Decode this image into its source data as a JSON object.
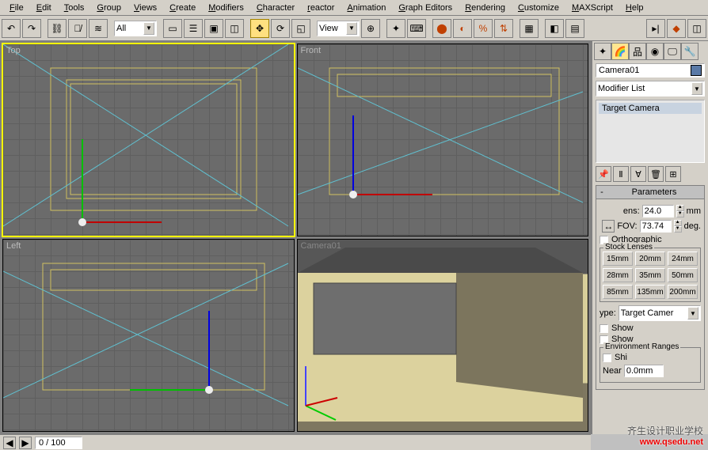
{
  "menu": {
    "file": "File",
    "edit": "Edit",
    "tools": "Tools",
    "group": "Group",
    "views": "Views",
    "create": "Create",
    "modifiers": "Modifiers",
    "character": "Character",
    "reactor": "reactor",
    "animation": "Animation",
    "graph_editors": "Graph Editors",
    "rendering": "Rendering",
    "customize": "Customize",
    "maxscript": "MAXScript",
    "help": "Help"
  },
  "toolbar": {
    "selection_filter": "All",
    "view_combo": "View"
  },
  "viewports": {
    "top": "Top",
    "front": "Front",
    "left": "Left",
    "camera": "Camera01"
  },
  "cmdpanel": {
    "object_name": "Camera01",
    "color": "#5a7aa7",
    "modifier_list_label": "Modifier List",
    "stack_item": "Target Camera"
  },
  "params": {
    "title": "Parameters",
    "lens_label": "ens:",
    "lens_value": "24.0",
    "lens_unit": "mm",
    "fov_label": "FOV:",
    "fov_value": "73.74",
    "fov_unit": "deg.",
    "ortho_label": "Orthographic",
    "stock_title": "Stock Lenses",
    "lenses": [
      "15mm",
      "20mm",
      "24mm",
      "28mm",
      "35mm",
      "50mm",
      "85mm",
      "135mm",
      "200mm"
    ],
    "type_label": "ype:",
    "type_value": "Target Camer",
    "show1": "Show",
    "show2": "Show",
    "env_title": "Environment Ranges",
    "near_label": "Near",
    "near_value": "0.0mm",
    "show_env": "Shi"
  },
  "status": {
    "frame": "0 / 100"
  },
  "watermark": {
    "line1": "齐生设计职业学校",
    "line2": "www.qsedu.net"
  }
}
